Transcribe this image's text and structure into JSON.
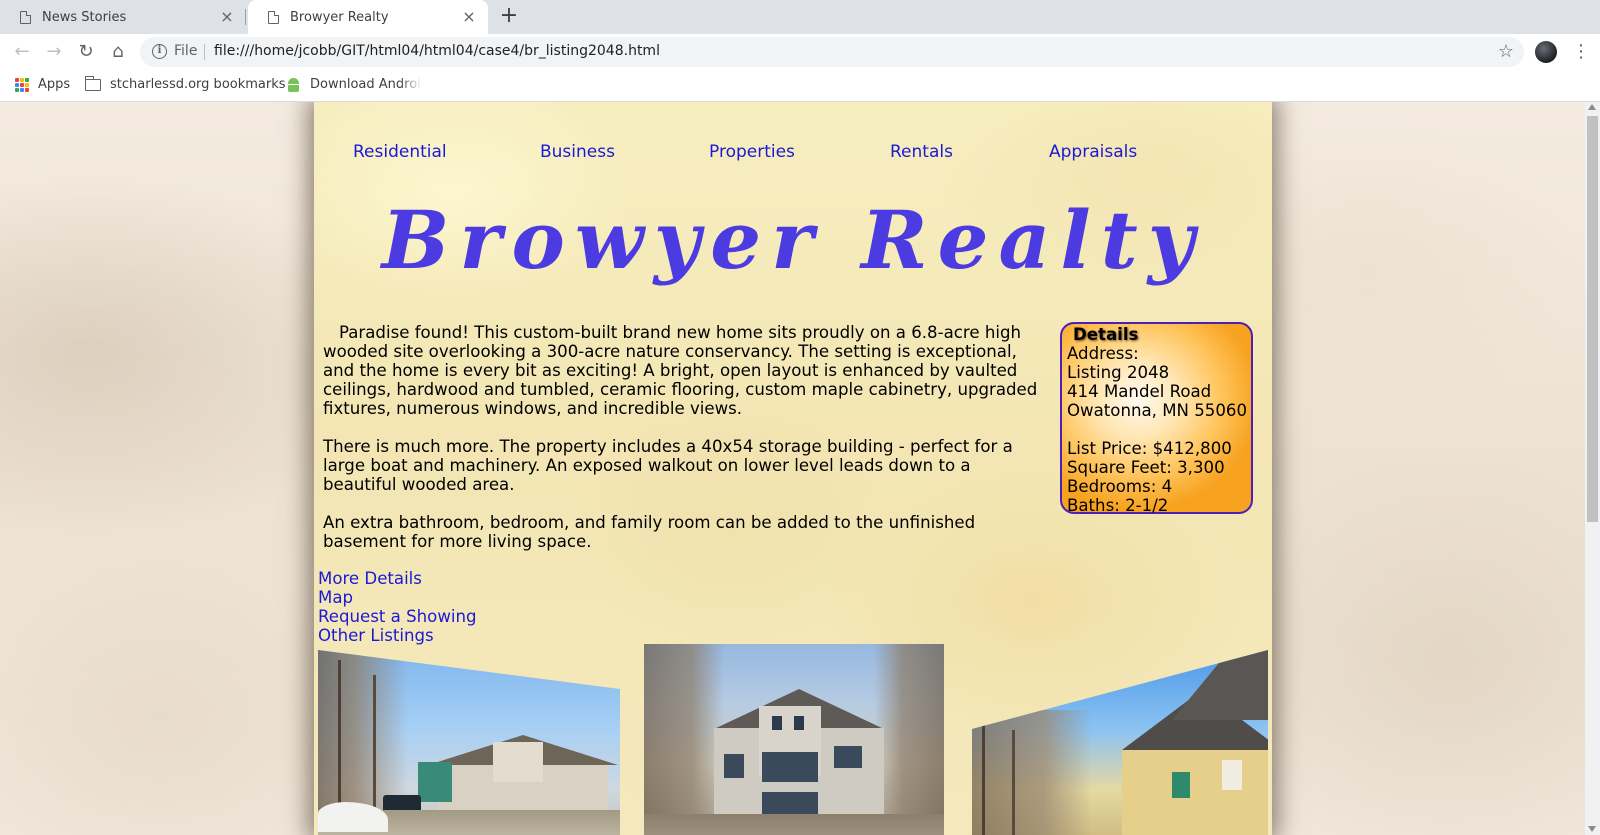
{
  "browser": {
    "tabs": [
      {
        "title": "News Stories",
        "active": false
      },
      {
        "title": "Browyer Realty",
        "active": true
      }
    ],
    "url_scheme_label": "File",
    "url": "file:///home/jcobb/GIT/html04/html04/case4/br_listing2048.html",
    "bookmarks": [
      {
        "label": "Apps",
        "icon": "apps-grid-icon"
      },
      {
        "label": "stcharlessd.org bookmarks",
        "icon": "folder-icon"
      },
      {
        "label": "Download Android",
        "icon": "android-icon"
      }
    ]
  },
  "site": {
    "nav": [
      "Residential",
      "Business",
      "Properties",
      "Rentals",
      "Appraisals"
    ],
    "brand": "Browyer Realty",
    "description": [
      "Paradise found! This custom-built brand new home sits proudly on a 6.8-acre high wooded site overlooking a 300-acre nature conservancy. The setting is exceptional, and the home is every bit as exciting! A bright, open layout is enhanced by vaulted ceilings, hardwood and tumbled, ceramic flooring, custom maple cabinetry, upgraded fixtures, numerous windows, and incredible views.",
      "There is much more. The property includes a 40x54 storage building - perfect for a large boat and machinery. An exposed walkout on lower level leads down to a beautiful wooded area.",
      "An extra bathroom, bedroom, and family room can be added to the unfinished basement for more living space."
    ],
    "details": {
      "heading": "Details",
      "address_label": "Address:",
      "listing": "Listing 2048",
      "street": "414 Mandel Road",
      "city": "Owatonna, MN 55060",
      "list_price": "List Price: $412,800",
      "square_feet": "Square Feet: 3,300",
      "bedrooms": "Bedrooms: 4",
      "baths": "Baths: 2-1/2"
    },
    "links": [
      "More Details",
      "Map",
      "Request a Showing",
      "Other Listings"
    ]
  },
  "colors": {
    "link": "#1a1ad6",
    "brand": "#4b3be0",
    "details_border": "#4d1fb5"
  }
}
